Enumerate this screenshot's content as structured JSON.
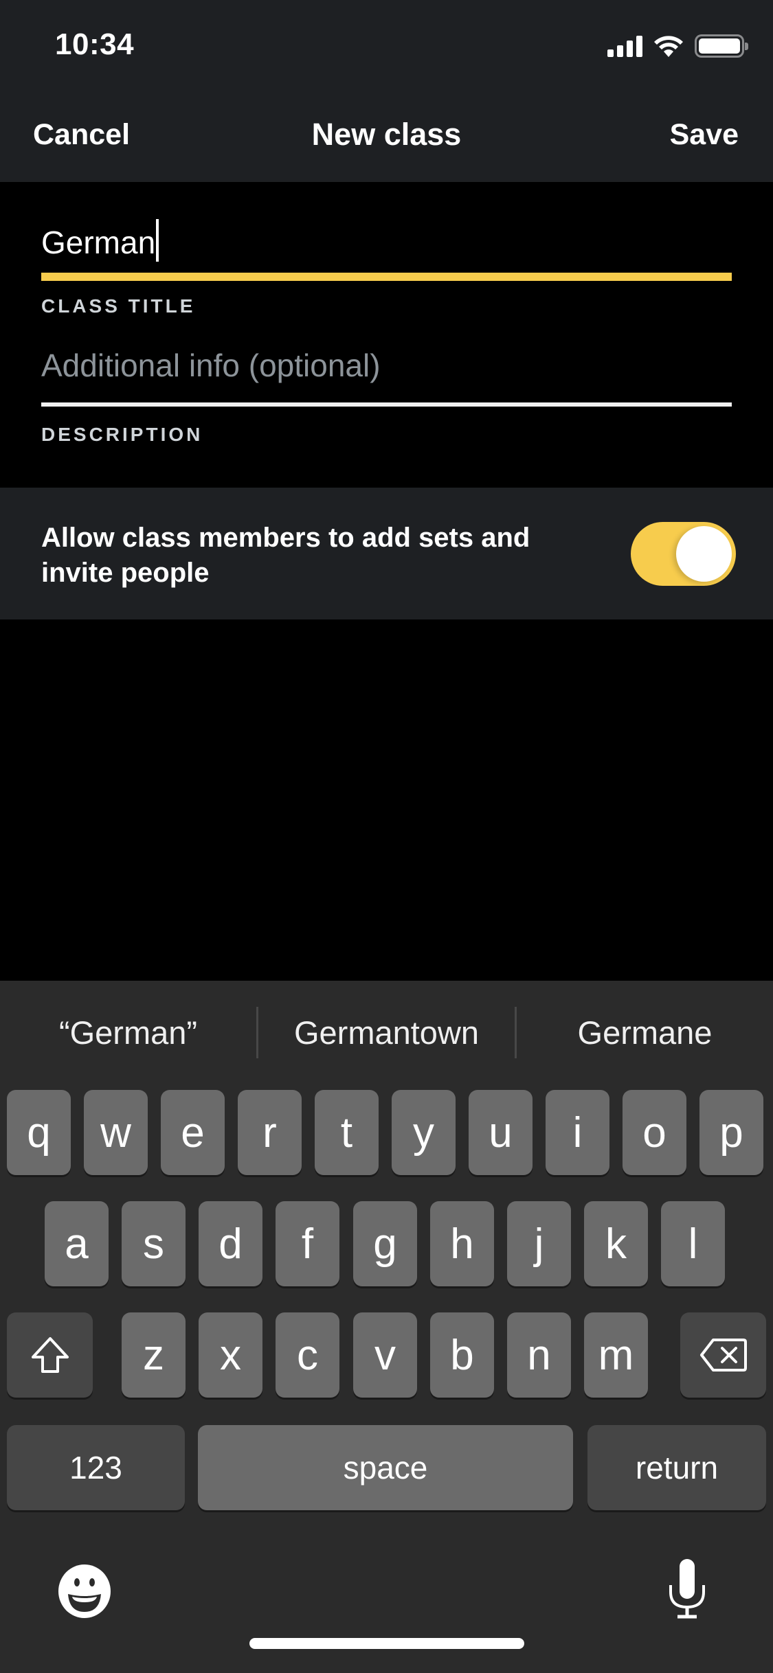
{
  "status_bar": {
    "time": "10:34",
    "icons": [
      "cellular-signal-icon",
      "wifi-icon",
      "battery-icon"
    ]
  },
  "nav": {
    "cancel_label": "Cancel",
    "title": "New class",
    "save_label": "Save"
  },
  "form": {
    "class_title": {
      "value": "German",
      "label": "CLASS TITLE"
    },
    "description": {
      "value": "",
      "placeholder": "Additional info (optional)",
      "label": "DESCRIPTION"
    }
  },
  "settings": {
    "allow_members_label": "Allow class members to add sets and invite people",
    "allow_members_enabled": true
  },
  "colors": {
    "accent": "#f7cc4d",
    "header_bg": "#1e2023",
    "keyboard_bg": "#2b2b2b"
  },
  "keyboard": {
    "suggestions": [
      "“German”",
      "Germantown",
      "Germane"
    ],
    "row1": [
      "q",
      "w",
      "e",
      "r",
      "t",
      "y",
      "u",
      "i",
      "o",
      "p"
    ],
    "row2": [
      "a",
      "s",
      "d",
      "f",
      "g",
      "h",
      "j",
      "k",
      "l"
    ],
    "row3": [
      "z",
      "x",
      "c",
      "v",
      "b",
      "n",
      "m"
    ],
    "numbers_label": "123",
    "space_label": "space",
    "return_label": "return",
    "shift_icon": "shift-icon",
    "delete_icon": "delete-icon",
    "emoji_icon": "emoji-icon",
    "mic_icon": "microphone-icon"
  }
}
